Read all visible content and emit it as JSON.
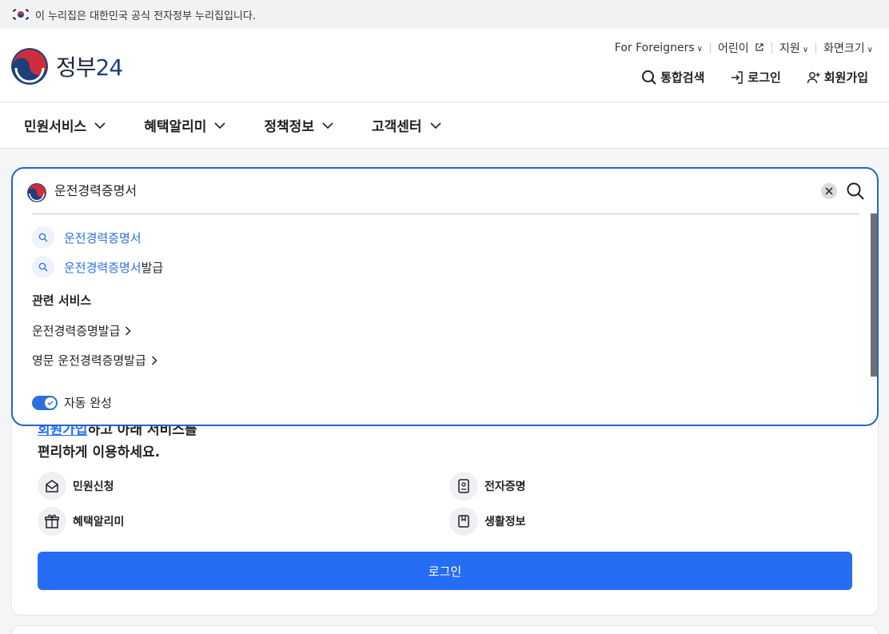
{
  "banner": {
    "text": "이 누리집은 대한민국 공식 전자정부 누리집입니다."
  },
  "logo": {
    "text_main": "정부",
    "text_num": "24"
  },
  "util": {
    "foreigners": "For Foreigners",
    "kids": "어린이",
    "support": "지원",
    "screen_size": "화면크기"
  },
  "main_links": {
    "search": "통합검색",
    "login": "로그인",
    "signup": "회원가입"
  },
  "gnb": [
    {
      "label": "민원서비스"
    },
    {
      "label": "혜택알리미"
    },
    {
      "label": "정책정보"
    },
    {
      "label": "고객센터"
    }
  ],
  "search": {
    "value": "운전경력증명서",
    "suggestions": [
      {
        "highlight": "운전경력증명서",
        "rest": ""
      },
      {
        "highlight": "운전경력증명서",
        "rest": "발급"
      }
    ],
    "related_title": "관련 서비스",
    "related": [
      {
        "label": "운전경력증명발급"
      },
      {
        "label": "영문 운전경력증명발급"
      }
    ],
    "autocomplete_label": "자동 완성",
    "autocomplete_on": true
  },
  "card": {
    "title_accent": "회원가입",
    "title_rest": "하고 아래 서비스를",
    "title_line2": "편리하게 이용하세요.",
    "quick": [
      {
        "label": "민원신청",
        "icon": "mail-icon"
      },
      {
        "label": "전자증명",
        "icon": "certificate-icon"
      },
      {
        "label": "혜택알리미",
        "icon": "gift-icon"
      },
      {
        "label": "생활정보",
        "icon": "bookmark-icon"
      }
    ],
    "login_button": "로그인"
  },
  "colors": {
    "accent": "#256ef4",
    "highlight": "#2a6fdb",
    "border": "#2763c9"
  }
}
